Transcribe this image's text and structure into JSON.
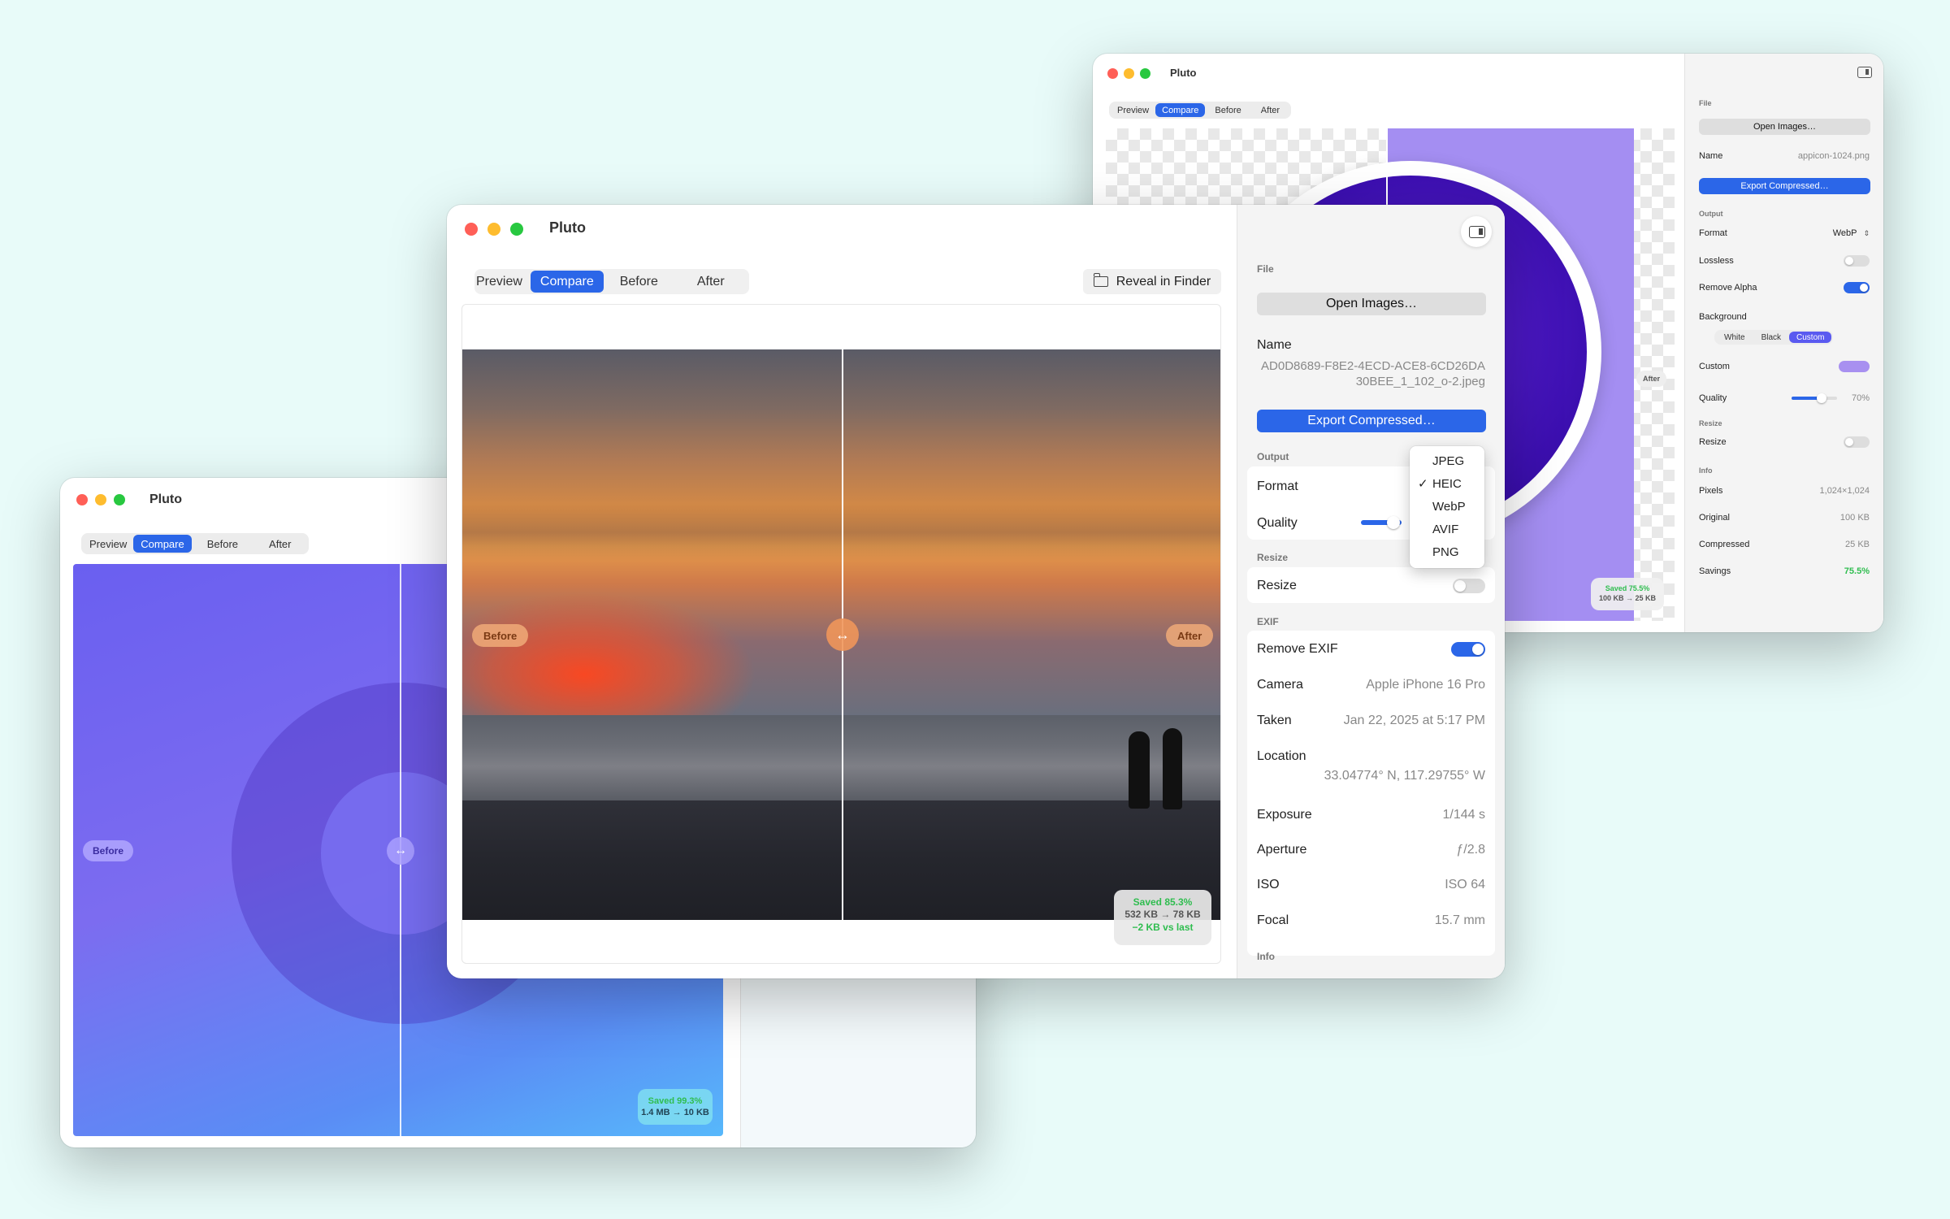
{
  "app": {
    "title": "Pluto"
  },
  "back_window": {
    "tabs": [
      "Preview",
      "Compare",
      "Before",
      "After"
    ],
    "after_label": "After",
    "stats": {
      "saved": "Saved 75.5%",
      "sizes": "100 KB → 25 KB"
    },
    "sidebar": {
      "file_section": "File",
      "open_button": "Open Images…",
      "name_label": "Name",
      "name_value": "appicon-1024.png",
      "export_button": "Export Compressed…",
      "output_section": "Output",
      "format_label": "Format",
      "format_value": "WebP",
      "lossless_label": "Lossless",
      "lossless_on": false,
      "remove_alpha_label": "Remove Alpha",
      "remove_alpha_on": true,
      "background_label": "Background",
      "background_options": [
        "White",
        "Black",
        "Custom"
      ],
      "background_selected": "Custom",
      "custom_label": "Custom",
      "custom_color": "#a890f0",
      "quality_label": "Quality",
      "quality_value": "70%",
      "quality_fraction": 0.7,
      "resize_section": "Resize",
      "resize_label": "Resize",
      "resize_on": false,
      "info_section": "Info",
      "info": [
        {
          "label": "Pixels",
          "value": "1,024×1,024"
        },
        {
          "label": "Original",
          "value": "100 KB"
        },
        {
          "label": "Compressed",
          "value": "25 KB"
        },
        {
          "label": "Savings",
          "value": "75.5%"
        }
      ]
    }
  },
  "left_window": {
    "tabs": [
      "Preview",
      "Compare",
      "Before",
      "After"
    ],
    "before_label": "Before",
    "stats": {
      "saved": "Saved 99.3%",
      "sizes": "1.4 MB → 10 KB"
    }
  },
  "front_window": {
    "tabs": [
      "Preview",
      "Compare",
      "Before",
      "After"
    ],
    "reveal_button": "Reveal in Finder",
    "before_label": "Before",
    "after_label": "After",
    "stats": {
      "saved": "Saved 85.3%",
      "sizes": "532 KB → 78 KB",
      "delta": "−2 KB vs last"
    },
    "sidebar": {
      "file_section": "File",
      "open_button": "Open Images…",
      "name_label": "Name",
      "name_value": "AD0D8689-F8E2-4ECD-ACE8-6CD26DA30BEE_1_102_o-2.jpeg",
      "export_button": "Export Compressed…",
      "output_section": "Output",
      "format_label": "Format",
      "format_menu": [
        "JPEG",
        "HEIC",
        "WebP",
        "AVIF",
        "PNG"
      ],
      "format_selected": "HEIC",
      "check_mark": "✓",
      "quality_label": "Quality",
      "resize_section": "Resize",
      "resize_label": "Resize",
      "resize_on": false,
      "exif_section": "EXIF",
      "remove_exif_label": "Remove EXIF",
      "remove_exif_on": true,
      "exif": [
        {
          "label": "Camera",
          "value": "Apple iPhone 16 Pro"
        },
        {
          "label": "Taken",
          "value": "Jan 22, 2025 at 5:17 PM"
        },
        {
          "label": "Location",
          "value": "33.04774° N, 117.29755° W"
        },
        {
          "label": "Exposure",
          "value": "1/144 s"
        },
        {
          "label": "Aperture",
          "value": "ƒ/2.8"
        },
        {
          "label": "ISO",
          "value": "ISO 64"
        },
        {
          "label": "Focal",
          "value": "15.7 mm"
        }
      ],
      "info_section": "Info"
    }
  },
  "colors": {
    "accent": "#2b66e8",
    "green": "#2fbd4f",
    "purple": "#6d28d9"
  }
}
